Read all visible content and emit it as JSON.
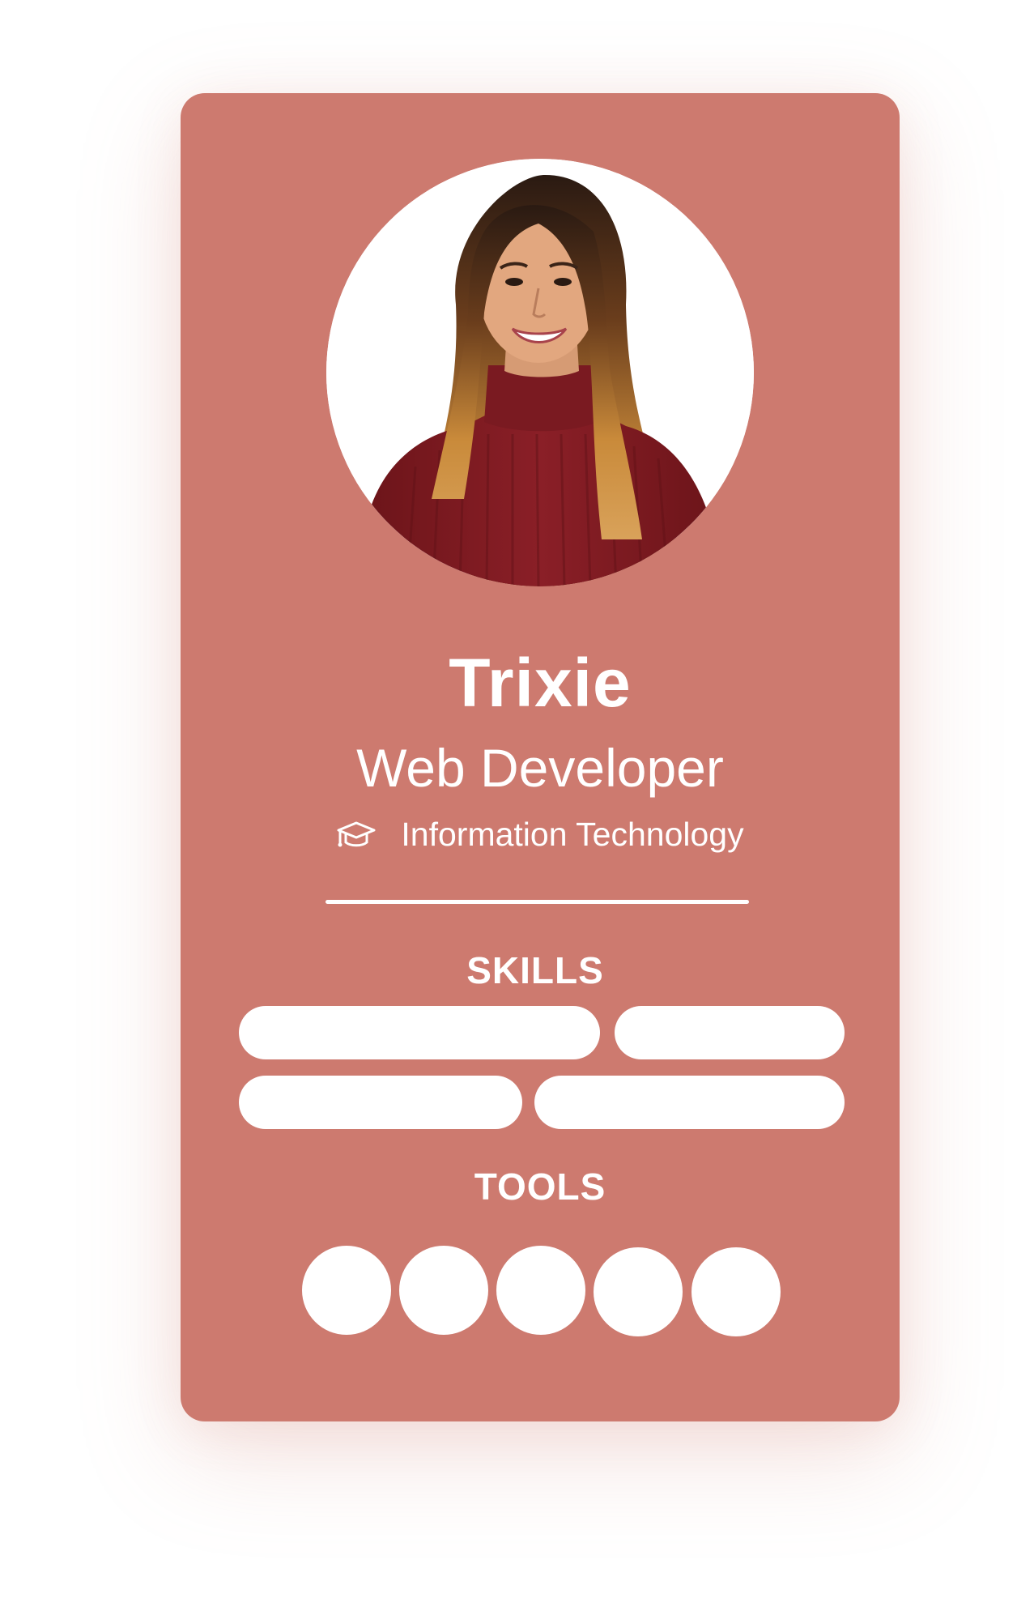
{
  "profile": {
    "name": "Trixie",
    "role": "Web Developer",
    "department": "Information Technology",
    "department_icon": "graduation-cap-icon"
  },
  "sections": {
    "skills_label": "SKILLS",
    "tools_label": "TOOLS"
  },
  "skills": [
    "",
    "",
    "",
    ""
  ],
  "tools": [
    "",
    "",
    "",
    "",
    ""
  ],
  "colors": {
    "card": "#cd7a6f",
    "foreground": "#ffffff",
    "sweater": "#7d1a22",
    "hair_dark": "#2a1a12",
    "hair_light": "#c98a3a",
    "skin": "#e2a77f"
  }
}
